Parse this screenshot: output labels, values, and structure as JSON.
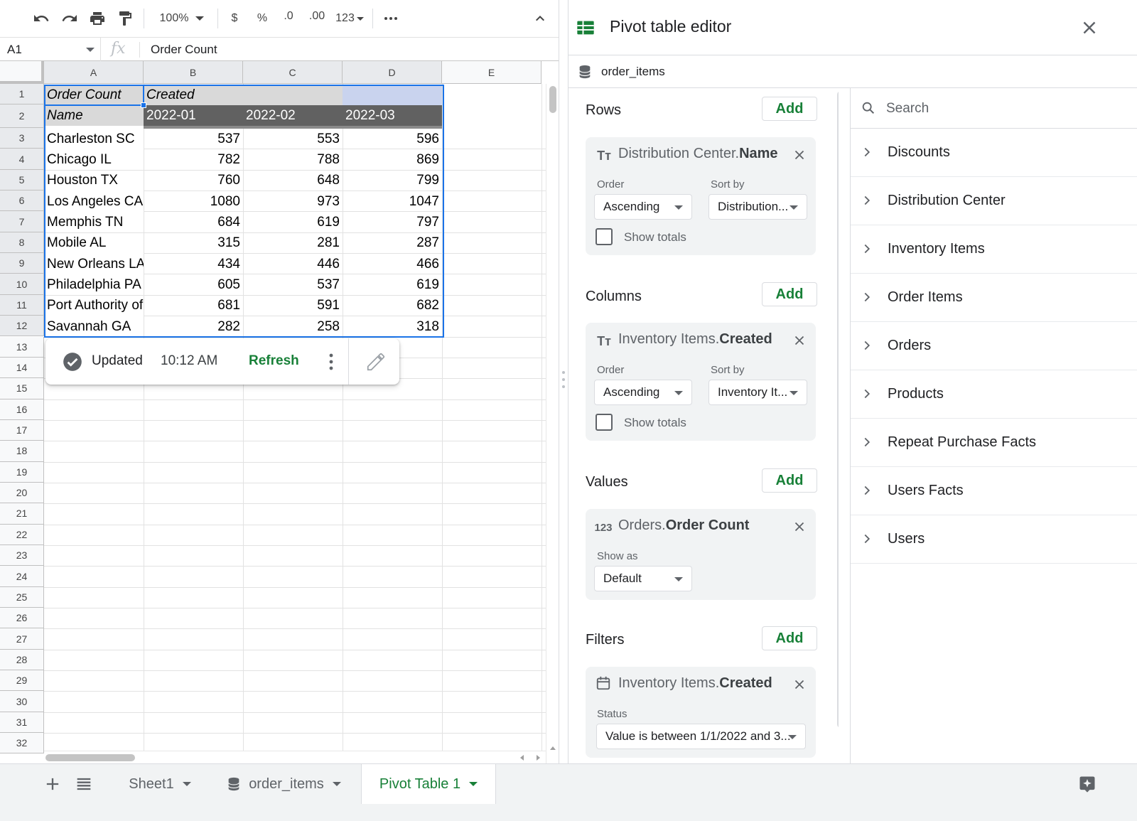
{
  "toolbar": {
    "zoom": "100%",
    "currency": "$",
    "percent": "%",
    "decrease_decimal": ".0",
    "increase_decimal": ".00",
    "number_format": "123"
  },
  "formula_bar": {
    "cell_ref": "A1",
    "fx": "fx",
    "content": "Order Count"
  },
  "grid": {
    "columns": [
      "A",
      "B",
      "C",
      "D",
      "E"
    ],
    "row_numbers": [
      "1",
      "2",
      "3",
      "4",
      "5",
      "6",
      "7",
      "8",
      "9",
      "10",
      "11",
      "12",
      "13",
      "14",
      "15",
      "16",
      "17",
      "18",
      "19",
      "20",
      "21",
      "22",
      "23",
      "24",
      "25",
      "26",
      "27",
      "28",
      "29",
      "30",
      "31",
      "32"
    ],
    "header1": {
      "a": "Order Count",
      "b": "Created"
    },
    "header2": {
      "a": "Name",
      "b": "2022-01",
      "c": "2022-02",
      "d": "2022-03"
    },
    "rows": [
      {
        "name": "Charleston SC",
        "b": "537",
        "c": "553",
        "d": "596"
      },
      {
        "name": "Chicago IL",
        "b": "782",
        "c": "788",
        "d": "869"
      },
      {
        "name": "Houston TX",
        "b": "760",
        "c": "648",
        "d": "799"
      },
      {
        "name": "Los Angeles CA",
        "b": "1080",
        "c": "973",
        "d": "1047"
      },
      {
        "name": "Memphis TN",
        "b": "684",
        "c": "619",
        "d": "797"
      },
      {
        "name": "Mobile AL",
        "b": "315",
        "c": "281",
        "d": "287"
      },
      {
        "name": "New Orleans LA",
        "b": "434",
        "c": "446",
        "d": "466"
      },
      {
        "name": "Philadelphia PA",
        "b": "605",
        "c": "537",
        "d": "619"
      },
      {
        "name": "Port Authority of",
        "b": "681",
        "c": "591",
        "d": "682"
      },
      {
        "name": "Savannah GA",
        "b": "282",
        "c": "258",
        "d": "318"
      }
    ]
  },
  "popup": {
    "status": "Updated",
    "time": "10:12 AM",
    "refresh": "Refresh"
  },
  "editor": {
    "title": "Pivot table editor",
    "source": "order_items",
    "add_label": "Add",
    "rows": {
      "title": "Rows",
      "field_prefix": "Distribution Center.",
      "field_name": "Name",
      "order_label": "Order",
      "order_value": "Ascending",
      "sort_label": "Sort by",
      "sort_value": "Distribution...",
      "totals_label": "Show totals"
    },
    "columns": {
      "title": "Columns",
      "field_prefix": "Inventory Items.",
      "field_name": "Created",
      "order_label": "Order",
      "order_value": "Ascending",
      "sort_label": "Sort by",
      "sort_value": "Inventory It...",
      "totals_label": "Show totals"
    },
    "values": {
      "title": "Values",
      "icon_text": "123",
      "field_prefix": "Orders.",
      "field_name": "Order Count",
      "show_as_label": "Show as",
      "show_as_value": "Default"
    },
    "filters": {
      "title": "Filters",
      "field_prefix": "Inventory Items.",
      "field_name": "Created",
      "status_label": "Status",
      "status_value": "Value is between 1/1/2022 and 3..."
    },
    "search_placeholder": "Search",
    "fields": [
      "Discounts",
      "Distribution Center",
      "Inventory Items",
      "Order Items",
      "Orders",
      "Products",
      "Repeat Purchase Facts",
      "Users Facts",
      "Users"
    ]
  },
  "tabs": [
    {
      "label": "Sheet1"
    },
    {
      "label": "order_items"
    },
    {
      "label": "Pivot Table 1"
    }
  ],
  "colors": {
    "accent_green": "#188038",
    "selection_blue": "#1a73e8",
    "header_dark": "#5f5f5f"
  }
}
